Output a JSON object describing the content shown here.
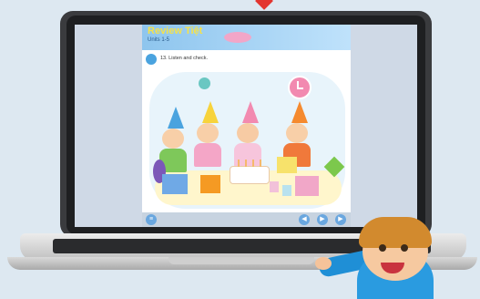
{
  "lesson": {
    "title": "Review Tiệt",
    "subtitle": "Units 1-5",
    "instruction_number": "1",
    "instruction": "13. Listen and check."
  },
  "bottom_bar": {
    "left_icon": "menu-icon",
    "right_icons": [
      "back-icon",
      "play-icon",
      "forward-icon"
    ]
  },
  "colors": {
    "banner": "#8ec5ee",
    "title": "#f6e24a",
    "laptop": "#3a3b3e",
    "accent": "#4aa3df"
  }
}
